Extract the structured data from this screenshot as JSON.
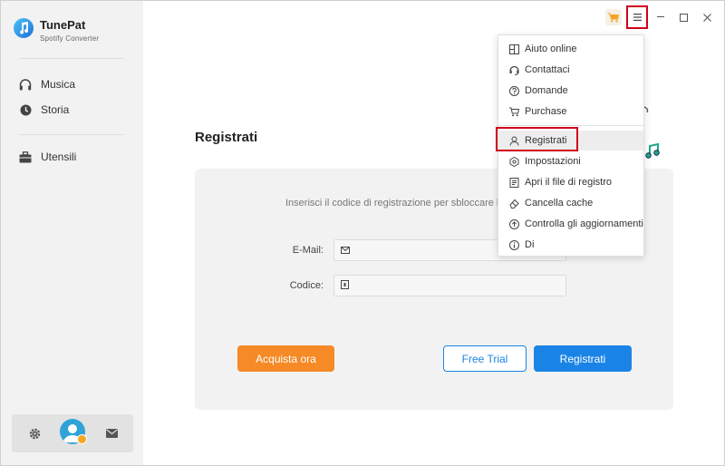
{
  "app": {
    "name": "TunePat",
    "subtitle": "Spotify Converter"
  },
  "sidebar": {
    "items": [
      {
        "label": "Musica",
        "icon": "headphones-icon"
      },
      {
        "label": "Storia",
        "icon": "clock-icon"
      },
      {
        "label": "Utensili",
        "icon": "toolbox-icon"
      }
    ],
    "bottom_icons": [
      "gear-icon",
      "avatar",
      "mail-icon"
    ]
  },
  "titlebar": {
    "icons": [
      "cart-icon",
      "menu-icon",
      "minimize-icon",
      "maximize-icon",
      "close-icon"
    ]
  },
  "main": {
    "title": "Registrati",
    "hint": "Inserisci il codice di registrazione per sbloccare la",
    "email_label": "E-Mail:",
    "email_value": "",
    "code_label": "Codice:",
    "code_value": "",
    "buy_button": "Acquista ora",
    "trial_button": "Free Trial",
    "register_button": "Registrati"
  },
  "menu": {
    "items": [
      {
        "label": "Aiuto online",
        "icon": "book-icon"
      },
      {
        "label": "Contattaci",
        "icon": "headset-icon"
      },
      {
        "label": "Domande",
        "icon": "question-icon"
      },
      {
        "label": "Purchase",
        "icon": "cart-icon"
      },
      {
        "label": "Registrati",
        "icon": "user-icon"
      },
      {
        "label": "Impostazioni",
        "icon": "settings-icon"
      },
      {
        "label": "Apri il file di registro",
        "icon": "log-file-icon"
      },
      {
        "label": "Cancella cache",
        "icon": "eraser-icon"
      },
      {
        "label": "Controlla gli aggiornamenti",
        "icon": "update-icon"
      },
      {
        "label": "Di",
        "icon": "info-icon"
      }
    ]
  },
  "colors": {
    "accent_blue": "#1a84e6",
    "accent_orange": "#f58a27",
    "highlight_red": "#d0021b",
    "sidebar_bg": "#f2f2f2"
  }
}
